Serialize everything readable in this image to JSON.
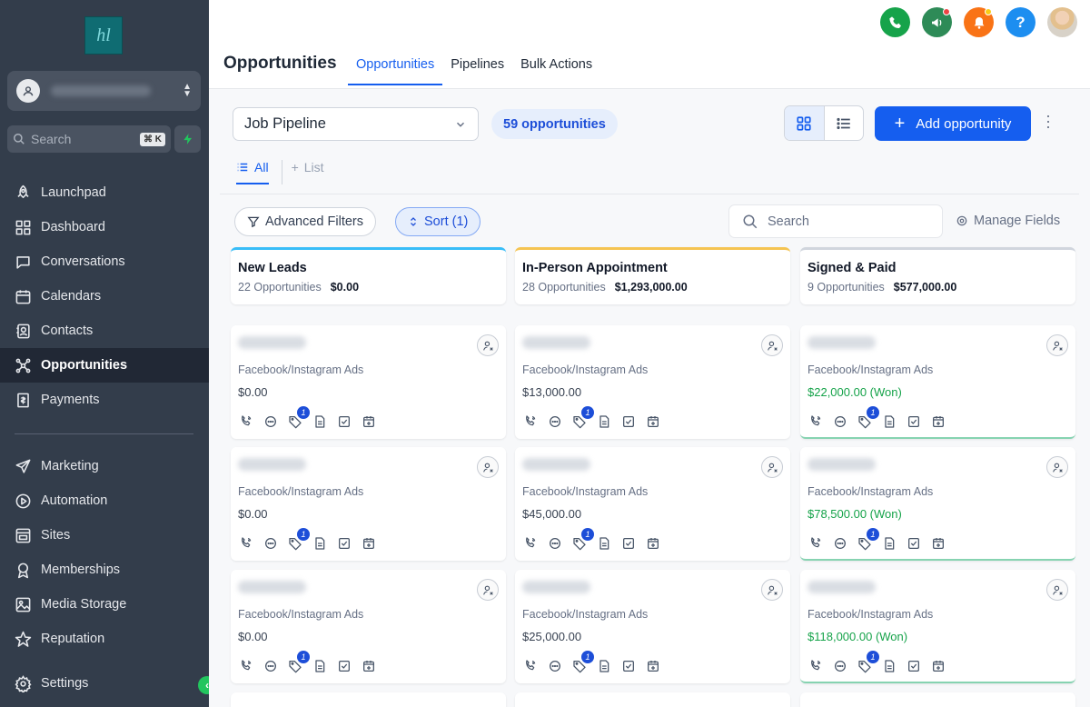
{
  "sidebar": {
    "logo_text": "hl",
    "search_placeholder": "Search",
    "search_shortcut": "⌘ K",
    "nav_top": [
      {
        "label": "Launchpad",
        "icon": "rocket-icon"
      },
      {
        "label": "Dashboard",
        "icon": "dashboard-icon"
      },
      {
        "label": "Conversations",
        "icon": "chat-icon"
      },
      {
        "label": "Calendars",
        "icon": "calendar-icon"
      },
      {
        "label": "Contacts",
        "icon": "contacts-icon"
      },
      {
        "label": "Opportunities",
        "icon": "opportunities-icon",
        "active": true
      },
      {
        "label": "Payments",
        "icon": "payments-icon"
      }
    ],
    "nav_bottom": [
      {
        "label": "Marketing",
        "icon": "send-icon"
      },
      {
        "label": "Automation",
        "icon": "automation-icon"
      },
      {
        "label": "Sites",
        "icon": "sites-icon"
      },
      {
        "label": "Memberships",
        "icon": "award-icon"
      },
      {
        "label": "Media Storage",
        "icon": "image-icon"
      },
      {
        "label": "Reputation",
        "icon": "star-icon"
      }
    ],
    "settings_label": "Settings"
  },
  "header": {
    "title": "Opportunities",
    "tabs": [
      "Opportunities",
      "Pipelines",
      "Bulk Actions"
    ],
    "active_tab": "Opportunities"
  },
  "toolbar": {
    "pipeline": "Job Pipeline",
    "count": "59 opportunities",
    "add_label": "Add opportunity",
    "subtab_all": "All",
    "subtab_list": "List",
    "filters_label": "Advanced Filters",
    "sort_label": "Sort (1)",
    "search_placeholder": "Search",
    "manage_label": "Manage Fields"
  },
  "colors": {
    "accent": "#155eef",
    "sidebar_bg": "#333d4b",
    "won_green": "#16a34a",
    "phone_green": "#16a34a",
    "megaphone_teal": "#2e8b57",
    "bell_orange": "#f97316",
    "help_blue": "#1d8ef0"
  },
  "columns": [
    {
      "name": "New Leads",
      "count": "22 Opportunities",
      "total": "$0.00",
      "cards": [
        {
          "source": "Facebook/Instagram Ads",
          "value": "$0.00",
          "badge": "1"
        },
        {
          "source": "Facebook/Instagram Ads",
          "value": "$0.00",
          "badge": "1"
        },
        {
          "source": "Facebook/Instagram Ads",
          "value": "$0.00",
          "badge": "1"
        }
      ]
    },
    {
      "name": "In-Person Appointment",
      "count": "28 Opportunities",
      "total": "$1,293,000.00",
      "cards": [
        {
          "source": "Facebook/Instagram Ads",
          "value": "$13,000.00",
          "badge": "1"
        },
        {
          "source": "Facebook/Instagram Ads",
          "value": "$45,000.00",
          "badge": "1"
        },
        {
          "source": "Facebook/Instagram Ads",
          "value": "$25,000.00",
          "badge": "1"
        }
      ]
    },
    {
      "name": "Signed & Paid",
      "count": "9 Opportunities",
      "total": "$577,000.00",
      "cards": [
        {
          "source": "Facebook/Instagram Ads",
          "value": "$22,000.00 (Won)",
          "badge": "1",
          "won": true
        },
        {
          "source": "Facebook/Instagram Ads",
          "value": "$78,500.00 (Won)",
          "badge": "1",
          "won": true
        },
        {
          "source": "Facebook/Instagram Ads",
          "value": "$118,000.00 (Won)",
          "badge": "1",
          "won": true
        }
      ]
    }
  ]
}
